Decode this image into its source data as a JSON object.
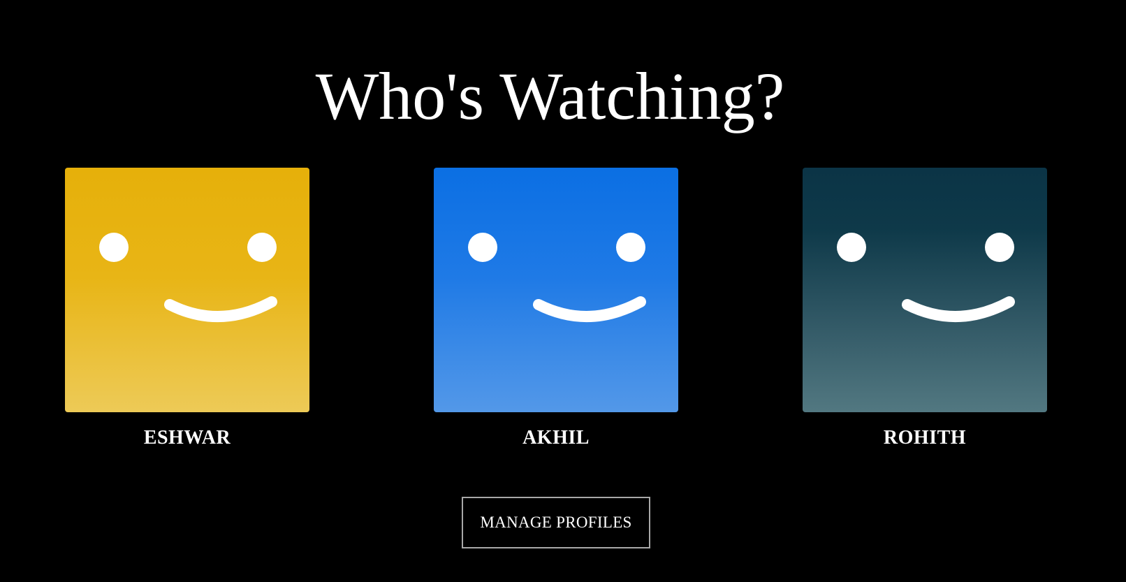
{
  "page": {
    "title": "Who's Watching?",
    "background": "#000000"
  },
  "profiles": [
    {
      "name": "ESHWAR",
      "avatar_color": "#e8b516",
      "icon": "smiley-face-icon"
    },
    {
      "name": "AKHIL",
      "avatar_color": "#1f7ae6",
      "icon": "smiley-face-icon"
    },
    {
      "name": "ROHITH",
      "avatar_color": "#0e3949",
      "icon": "smiley-face-icon"
    }
  ],
  "manage": {
    "label": "MANAGE PROFILES"
  }
}
